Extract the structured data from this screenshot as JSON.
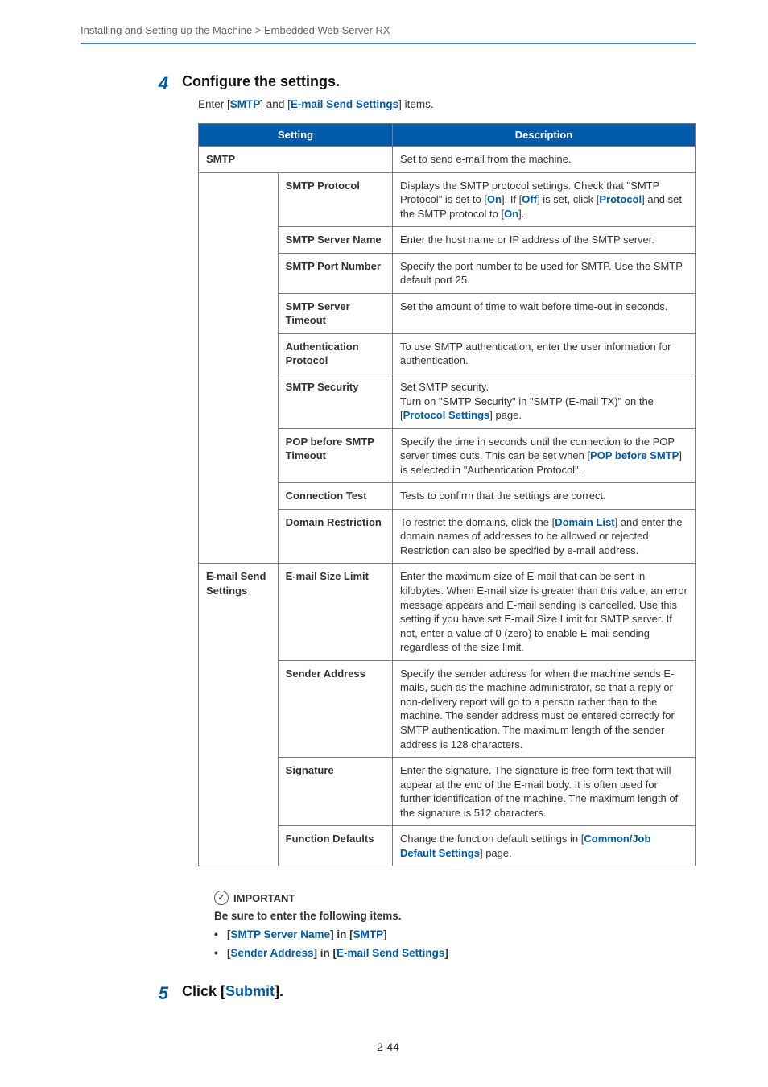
{
  "breadcrumb": "Installing and Setting up the Machine > Embedded Web Server RX",
  "step4": {
    "number": "4",
    "title": "Configure the settings.",
    "intro_prefix": "Enter [",
    "intro_link1": "SMTP",
    "intro_mid": "] and [",
    "intro_link2": "E-mail Send Settings",
    "intro_suffix": "] items."
  },
  "table": {
    "header_setting": "Setting",
    "header_description": "Description",
    "smtp_label": "SMTP",
    "smtp_desc": "Set to send e-mail from the machine.",
    "rows": [
      {
        "name": "SMTP Protocol",
        "desc_parts": [
          {
            "t": "Displays the SMTP protocol settings. Check that \"SMTP Protocol\" is set to ["
          },
          {
            "t": "On",
            "b": true
          },
          {
            "t": "]. If ["
          },
          {
            "t": "Off",
            "b": true
          },
          {
            "t": "] is set, click ["
          },
          {
            "t": "Protocol",
            "b": true
          },
          {
            "t": "] and set the SMTP protocol to ["
          },
          {
            "t": "On",
            "b": true
          },
          {
            "t": "]."
          }
        ]
      },
      {
        "name": "SMTP Server Name",
        "desc_parts": [
          {
            "t": "Enter the host name or IP address of the SMTP server."
          }
        ]
      },
      {
        "name": "SMTP Port Number",
        "desc_parts": [
          {
            "t": "Specify the port number to be used for SMTP. Use the SMTP default port 25."
          }
        ]
      },
      {
        "name": "SMTP Server Timeout",
        "desc_parts": [
          {
            "t": "Set the amount of time to wait before time-out in seconds."
          }
        ]
      },
      {
        "name": "Authentication Protocol",
        "desc_parts": [
          {
            "t": "To use SMTP authentication, enter the user information for authentication."
          }
        ]
      },
      {
        "name": "SMTP Security",
        "desc_parts": [
          {
            "t": "Set SMTP security."
          },
          {
            "br": true
          },
          {
            "t": "Turn on \"SMTP Security\" in \"SMTP (E-mail TX)\" on the ["
          },
          {
            "t": "Protocol Settings",
            "b": true
          },
          {
            "t": "] page."
          }
        ]
      },
      {
        "name": "POP before SMTP Timeout",
        "desc_parts": [
          {
            "t": "Specify the time in seconds until the connection to the POP server times outs. This can be set when ["
          },
          {
            "t": "POP before SMTP",
            "b": true
          },
          {
            "t": "] is selected in \"Authentication Protocol\"."
          }
        ]
      },
      {
        "name": "Connection Test",
        "desc_parts": [
          {
            "t": "Tests to confirm that the settings are correct."
          }
        ]
      },
      {
        "name": "Domain Restriction",
        "desc_parts": [
          {
            "t": "To restrict the domains, click the ["
          },
          {
            "t": "Domain List",
            "b": true
          },
          {
            "t": "] and enter the domain names of addresses to be allowed or rejected. Restriction can also be specified by e-mail address."
          }
        ]
      }
    ],
    "email_label": "E-mail Send Settings",
    "email_rows": [
      {
        "name": "E-mail Size Limit",
        "desc_parts": [
          {
            "t": "Enter the maximum size of E-mail that can be sent in kilobytes. When E-mail size is greater than this value, an error message appears and E-mail sending is cancelled. Use this setting if you have set E-mail Size Limit for SMTP server. If not, enter a value of 0 (zero) to enable E-mail sending regardless of the size limit."
          }
        ]
      },
      {
        "name": "Sender Address",
        "desc_parts": [
          {
            "t": "Specify the sender address for when the machine sends E-mails, such as the machine administrator, so that a reply or non-delivery report will go to a person rather than to the machine. The sender address must be entered correctly for SMTP authentication. The maximum length of the sender address is 128 characters."
          }
        ]
      },
      {
        "name": "Signature",
        "desc_parts": [
          {
            "t": "Enter the signature. The signature is free form text that will appear at the end of the E-mail body. It is often used for further identification of the machine. The maximum length of the signature is 512 characters."
          }
        ]
      },
      {
        "name": "Function Defaults",
        "desc_parts": [
          {
            "t": "Change the function default settings in ["
          },
          {
            "t": "Common/Job Default Settings",
            "b": true
          },
          {
            "t": "] page."
          }
        ]
      }
    ]
  },
  "important": {
    "label": "IMPORTANT",
    "line": "Be sure to enter the following items.",
    "bullets": [
      {
        "parts": [
          {
            "t": "["
          },
          {
            "t": "SMTP Server Name",
            "b": true
          },
          {
            "t": "] in ["
          },
          {
            "t": "SMTP",
            "b": true
          },
          {
            "t": "]"
          }
        ]
      },
      {
        "parts": [
          {
            "t": "["
          },
          {
            "t": "Sender Address",
            "b": true
          },
          {
            "t": "] in ["
          },
          {
            "t": "E-mail Send Settings",
            "b": true
          },
          {
            "t": "]"
          }
        ]
      }
    ]
  },
  "step5": {
    "number": "5",
    "title_prefix": "Click [",
    "title_link": "Submit",
    "title_suffix": "]."
  },
  "page_number": "2-44"
}
